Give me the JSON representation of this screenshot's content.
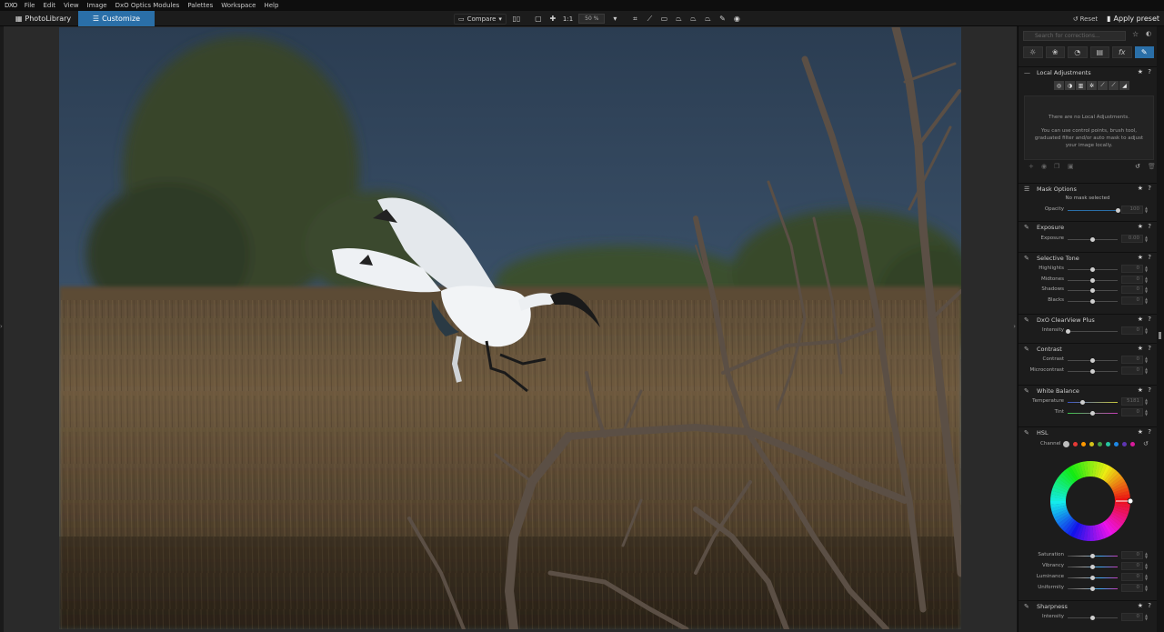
{
  "menubar": {
    "logo": "DXO",
    "items": [
      "File",
      "Edit",
      "View",
      "Image",
      "DxO Optics Modules",
      "Palettes",
      "Workspace",
      "Help"
    ]
  },
  "toolbar": {
    "tab_photolibrary": "PhotoLibrary",
    "tab_customize": "Customize",
    "compare": "Compare",
    "one_to_one": "1:1",
    "zoom": "50 %",
    "reset": "Reset",
    "apply_preset": "Apply preset"
  },
  "palette": {
    "search_placeholder": "Search for corrections...",
    "local_adjustments": {
      "title": "Local Adjustments",
      "empty": "There are no Local Adjustments.",
      "hint": "You can use control points, brush tool, graduated filter and/or auto mask to adjust your image locally."
    },
    "mask_options": {
      "title": "Mask Options",
      "subtitle": "No mask selected",
      "opacity_label": "Opacity",
      "opacity_value": "100",
      "opacity_level": 1.0
    },
    "exposure": {
      "title": "Exposure",
      "rows": [
        {
          "label": "Exposure",
          "value": "0.00",
          "level": 0.5
        }
      ]
    },
    "selective_tone": {
      "title": "Selective Tone",
      "rows": [
        {
          "label": "Highlights",
          "value": "0",
          "level": 0.5
        },
        {
          "label": "Midtones",
          "value": "0",
          "level": 0.5
        },
        {
          "label": "Shadows",
          "value": "0",
          "level": 0.5
        },
        {
          "label": "Blacks",
          "value": "0",
          "level": 0.5
        }
      ]
    },
    "clearview": {
      "title": "DxO ClearView Plus",
      "rows": [
        {
          "label": "Intensity",
          "value": "0",
          "level": 0.0
        }
      ]
    },
    "contrast": {
      "title": "Contrast",
      "rows": [
        {
          "label": "Contrast",
          "value": "0",
          "level": 0.5
        },
        {
          "label": "Microcontrast",
          "value": "0",
          "level": 0.5
        }
      ]
    },
    "white_balance": {
      "title": "White Balance",
      "rows": [
        {
          "label": "Temperature",
          "value": "5181",
          "level": 0.3
        },
        {
          "label": "Tint",
          "value": "0",
          "level": 0.5
        }
      ]
    },
    "hsl": {
      "title": "HSL",
      "channel_label": "Channel",
      "channel_colors": [
        "#bdbdbd",
        "#e53935",
        "#ff9800",
        "#d4c21a",
        "#43a047",
        "#26c6a0",
        "#1e88e5",
        "#5e35b1",
        "#d81b9a"
      ],
      "rows": [
        {
          "label": "Saturation",
          "value": "0",
          "level": 0.5
        },
        {
          "label": "Vibrancy",
          "value": "0",
          "level": 0.5
        },
        {
          "label": "Luminance",
          "value": "0",
          "level": 0.5
        },
        {
          "label": "Uniformity",
          "value": "0",
          "level": 0.5
        }
      ]
    },
    "sharpness": {
      "title": "Sharpness",
      "rows": [
        {
          "label": "Intensity",
          "value": "0",
          "level": 0.5
        }
      ]
    }
  }
}
